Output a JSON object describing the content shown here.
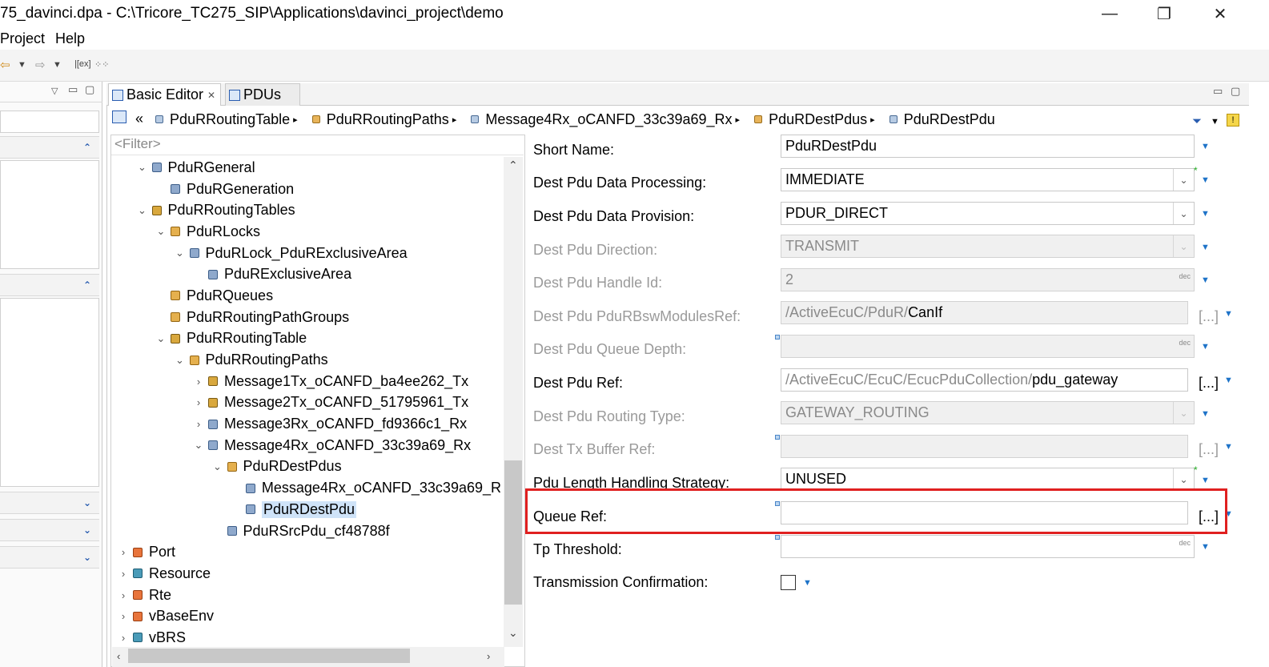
{
  "window": {
    "title": "75_davinci.dpa - C:\\Tricore_TC275_SIP\\Applications\\davinci_project\\demo",
    "minimize": "—",
    "restore": "❐",
    "close": "✕"
  },
  "menu": {
    "items": [
      "Project",
      "Help"
    ]
  },
  "toolbar": {
    "icons": [
      "back-arrow-icon",
      "dropdown-icon",
      "forward-arrow-icon",
      "dropdown-icon",
      "hex-icon",
      "grid-icon"
    ]
  },
  "tabs": [
    {
      "label": "Basic Editor",
      "active": true,
      "close": "✕"
    },
    {
      "label": "PDUs",
      "active": false
    }
  ],
  "breadcrumb": [
    "PduRRoutingTable",
    "PduRRoutingPaths",
    "Message4Rx_oCANFD_33c39a69_Rx",
    "PduRDestPdus",
    "PduRDestPdu"
  ],
  "filter": {
    "placeholder": "<Filter>"
  },
  "tree": [
    {
      "label": "PduRGeneral",
      "level": 1,
      "twisty": "v",
      "icon": "box"
    },
    {
      "label": "PduRGeneration",
      "level": 2,
      "twisty": "",
      "icon": "box"
    },
    {
      "label": "PduRRoutingTables",
      "level": 1,
      "twisty": "v",
      "icon": "pen"
    },
    {
      "label": "PduRLocks",
      "level": 2,
      "twisty": "v",
      "icon": "folder"
    },
    {
      "label": "PduRLock_PduRExclusiveArea",
      "level": 3,
      "twisty": "v",
      "icon": "box"
    },
    {
      "label": "PduRExclusiveArea",
      "level": 4,
      "twisty": "",
      "icon": "box"
    },
    {
      "label": "PduRQueues",
      "level": 2,
      "twisty": "",
      "icon": "folder"
    },
    {
      "label": "PduRRoutingPathGroups",
      "level": 2,
      "twisty": "",
      "icon": "folder"
    },
    {
      "label": "PduRRoutingTable",
      "level": 2,
      "twisty": "v",
      "icon": "pen"
    },
    {
      "label": "PduRRoutingPaths",
      "level": 3,
      "twisty": "v",
      "icon": "folder"
    },
    {
      "label": "Message1Tx_oCANFD_ba4ee262_Tx",
      "level": 4,
      "twisty": ">",
      "icon": "pen"
    },
    {
      "label": "Message2Tx_oCANFD_51795961_Tx",
      "level": 4,
      "twisty": ">",
      "icon": "pen"
    },
    {
      "label": "Message3Rx_oCANFD_fd9366c1_Rx",
      "level": 4,
      "twisty": ">",
      "icon": "box"
    },
    {
      "label": "Message4Rx_oCANFD_33c39a69_Rx",
      "level": 4,
      "twisty": "v",
      "icon": "box"
    },
    {
      "label": "PduRDestPdus",
      "level": 5,
      "twisty": "v",
      "icon": "folder"
    },
    {
      "label": "Message4Rx_oCANFD_33c39a69_R",
      "level": 6,
      "twisty": "",
      "icon": "box"
    },
    {
      "label": "PduRDestPdu",
      "level": 6,
      "twisty": "",
      "icon": "box",
      "selected": true
    },
    {
      "label": "PduRSrcPdu_cf48788f",
      "level": 5,
      "twisty": "",
      "icon": "box"
    },
    {
      "label": "Port",
      "level": 0,
      "twisty": ">",
      "icon": "orange"
    },
    {
      "label": "Resource",
      "level": 0,
      "twisty": ">",
      "icon": "teal"
    },
    {
      "label": "Rte",
      "level": 0,
      "twisty": ">",
      "icon": "orange"
    },
    {
      "label": "vBaseEnv",
      "level": 0,
      "twisty": ">",
      "icon": "orange"
    },
    {
      "label": "vBRS",
      "level": 0,
      "twisty": ">",
      "icon": "teal"
    }
  ],
  "form": {
    "short_name": {
      "label": "Short Name:",
      "value": "PduRDestPdu"
    },
    "data_processing": {
      "label": "Dest Pdu Data Processing:",
      "value": "IMMEDIATE"
    },
    "data_provision": {
      "label": "Dest Pdu Data Provision:",
      "value": "PDUR_DIRECT"
    },
    "direction": {
      "label": "Dest Pdu Direction:",
      "value": "TRANSMIT"
    },
    "handle_id": {
      "label": "Dest Pdu Handle Id:",
      "value": "2",
      "unit": "dec"
    },
    "bsw_modules_ref": {
      "label": "Dest Pdu PduRBswModulesRef:",
      "prefix": "/ActiveEcuC/PduR/",
      "value": "CanIf",
      "browse": "[...]"
    },
    "queue_depth": {
      "label": "Dest Pdu Queue Depth:",
      "value": "",
      "unit": "dec"
    },
    "dest_pdu_ref": {
      "label": "Dest Pdu Ref:",
      "prefix": "/ActiveEcuC/EcuC/EcucPduCollection/",
      "value": "pdu_gateway",
      "browse": "[...]"
    },
    "routing_type": {
      "label": "Dest Pdu Routing Type:",
      "value": "GATEWAY_ROUTING"
    },
    "tx_buffer_ref": {
      "label": "Dest Tx Buffer Ref:",
      "value": "",
      "browse": "[...]"
    },
    "length_handling": {
      "label": "Pdu Length Handling Strategy:",
      "value": "UNUSED"
    },
    "queue_ref": {
      "label": "Queue Ref:",
      "value": "",
      "browse": "[...]"
    },
    "tp_threshold": {
      "label": "Tp Threshold:",
      "value": "",
      "unit": "dec"
    },
    "tx_confirmation": {
      "label": "Transmission Confirmation:",
      "checked": false
    }
  }
}
